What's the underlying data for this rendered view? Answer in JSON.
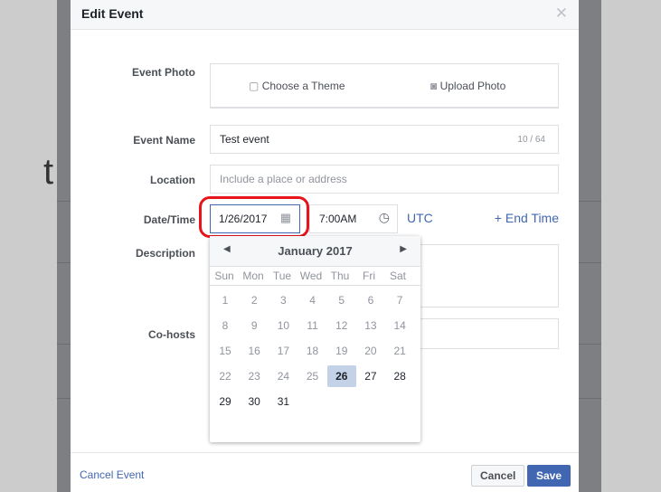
{
  "modal": {
    "title": "Edit Event",
    "close_icon": "close-icon"
  },
  "fields": {
    "photo_label": "Event Photo",
    "choose_theme": "Choose a Theme",
    "upload_photo": "Upload Photo",
    "name_label": "Event Name",
    "name_value": "Test event",
    "name_count": "10 / 64",
    "location_label": "Location",
    "location_placeholder": "Include a place or address",
    "datetime_label": "Date/Time",
    "date_value": "1/26/2017",
    "time_value": "7:00AM",
    "timezone": "UTC",
    "end_time": "+ End Time",
    "description_label": "Description",
    "cohosts_label": "Co-hosts"
  },
  "calendar": {
    "month": "January 2017",
    "weekdays": [
      "Sun",
      "Mon",
      "Tue",
      "Wed",
      "Thu",
      "Fri",
      "Sat"
    ],
    "days": [
      "1",
      "2",
      "3",
      "4",
      "5",
      "6",
      "7",
      "8",
      "9",
      "10",
      "11",
      "12",
      "13",
      "14",
      "15",
      "16",
      "17",
      "18",
      "19",
      "20",
      "21",
      "22",
      "23",
      "24",
      "25",
      "26",
      "27",
      "28",
      "29",
      "30",
      "31"
    ],
    "selected": "26"
  },
  "footer": {
    "cancel_event": "Cancel Event",
    "cancel": "Cancel",
    "save": "Save"
  },
  "colors": {
    "accent": "#4267b2",
    "highlight": "#e8141c",
    "selected_day": "#c4d2e7"
  }
}
